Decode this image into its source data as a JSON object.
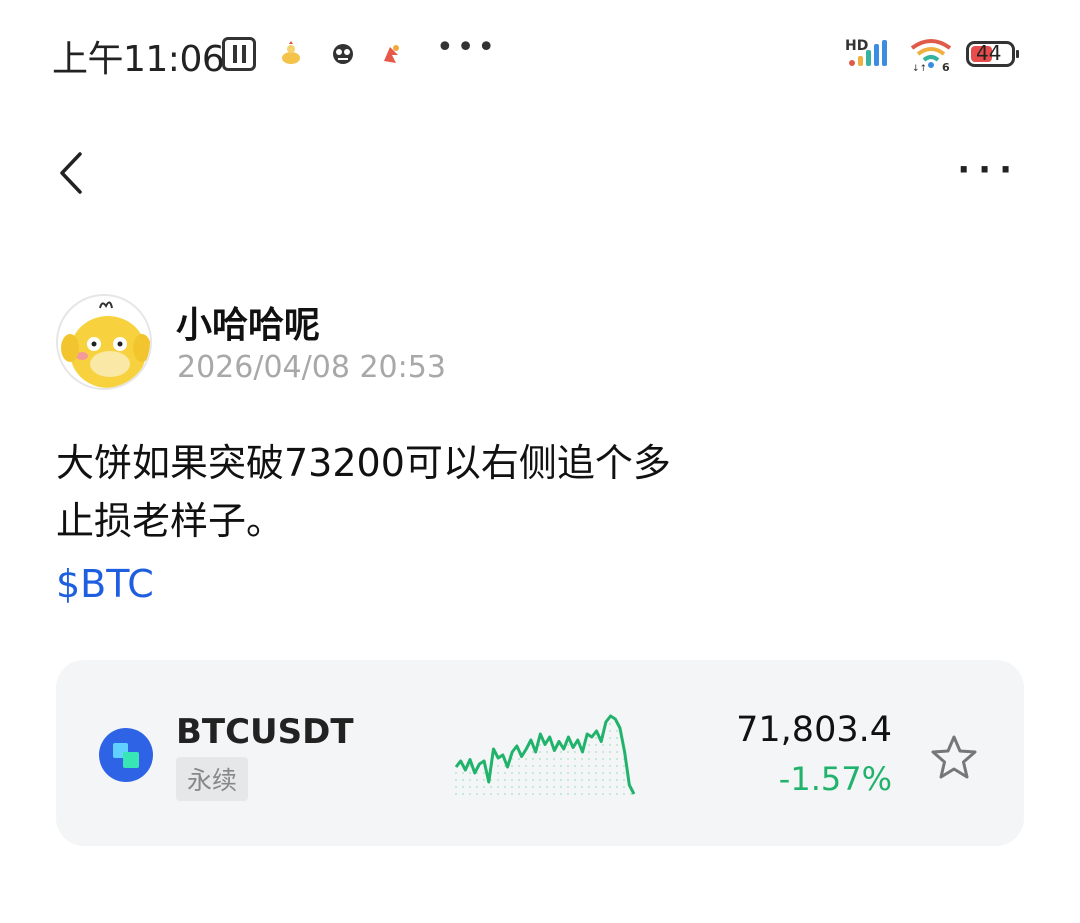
{
  "status_bar": {
    "time": "上午11:06",
    "more": "•••",
    "hd": "HD",
    "wifi_label": "6",
    "battery": "44"
  },
  "nav": {
    "back_icon": "chevron-left-icon",
    "more_label": "···"
  },
  "post": {
    "author": "小哈哈呢",
    "timestamp": "2026/04/08 20:53",
    "text_line1": "大饼如果突破73200可以右侧追个多",
    "text_line2": "止损老样子。",
    "tag": "$BTC"
  },
  "ticker": {
    "symbol": "BTCUSDT",
    "badge": "永续",
    "price": "71,803.4",
    "change": "-1.57%",
    "change_color": "#21b36b",
    "accent_color": "#2e63e6",
    "sparkline": [
      40,
      44,
      38,
      45,
      36,
      42,
      44,
      30,
      52,
      46,
      48,
      40,
      50,
      54,
      47,
      52,
      58,
      50,
      62,
      55,
      60,
      51,
      57,
      52,
      60,
      53,
      58,
      50,
      62,
      60,
      64,
      57,
      70,
      74,
      72,
      66,
      50,
      28,
      22
    ]
  }
}
